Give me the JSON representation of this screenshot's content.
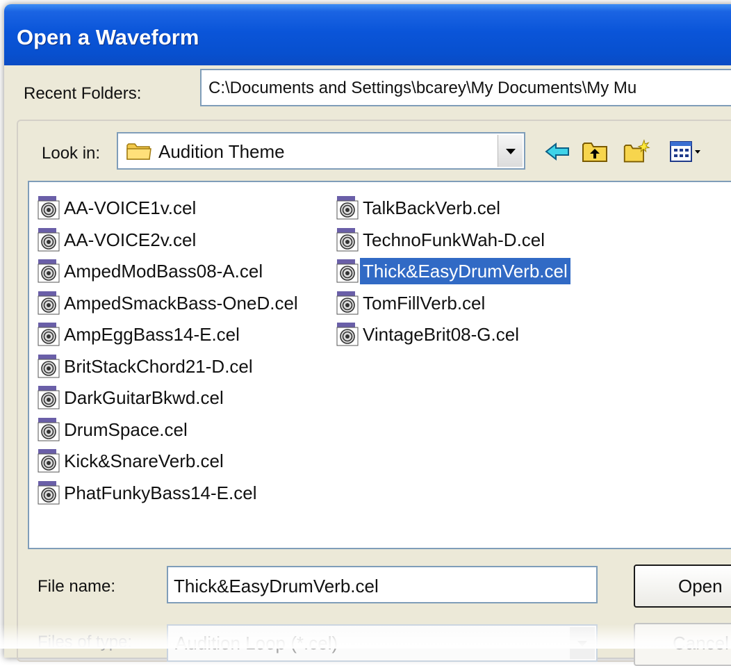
{
  "window": {
    "title": "Open a Waveform"
  },
  "recent_folders": {
    "label": "Recent Folders:",
    "value": "C:\\Documents and Settings\\bcarey\\My Documents\\My Mu"
  },
  "look_in": {
    "label": "Look in:",
    "value": "Audition Theme",
    "folder_icon": "folder-icon"
  },
  "toolbar": {
    "icons": [
      "back-arrow-icon",
      "up-folder-icon",
      "new-folder-icon",
      "view-menu-icon"
    ]
  },
  "file_list": {
    "selected": "Thick&EasyDrumVerb.cel",
    "columns": [
      {
        "items": [
          "AA-VOICE1v.cel",
          "AA-VOICE2v.cel",
          "AmpedModBass08-A.cel",
          "AmpedSmackBass-OneD.cel",
          "AmpEggBass14-E.cel",
          "BritStackChord21-D.cel",
          "DarkGuitarBkwd.cel",
          "DrumSpace.cel",
          "Kick&SnareVerb.cel",
          "PhatFunkyBass14-E.cel"
        ]
      },
      {
        "items": [
          "TalkBackVerb.cel",
          "TechnoFunkWah-D.cel",
          "Thick&EasyDrumVerb.cel",
          "TomFillVerb.cel",
          "VintageBrit08-G.cel"
        ]
      }
    ]
  },
  "file_name": {
    "label": "File name:",
    "value": "Thick&EasyDrumVerb.cel"
  },
  "files_of_type": {
    "label": "Files of type:",
    "value": "Audition Loop (*.cel)"
  },
  "buttons": {
    "open": "Open",
    "cancel": "Cancel"
  },
  "colors": {
    "title_bar": "#0a55d9",
    "dialog_bg": "#ece9d8",
    "selection": "#316ac5",
    "input_border": "#7f9db9"
  }
}
